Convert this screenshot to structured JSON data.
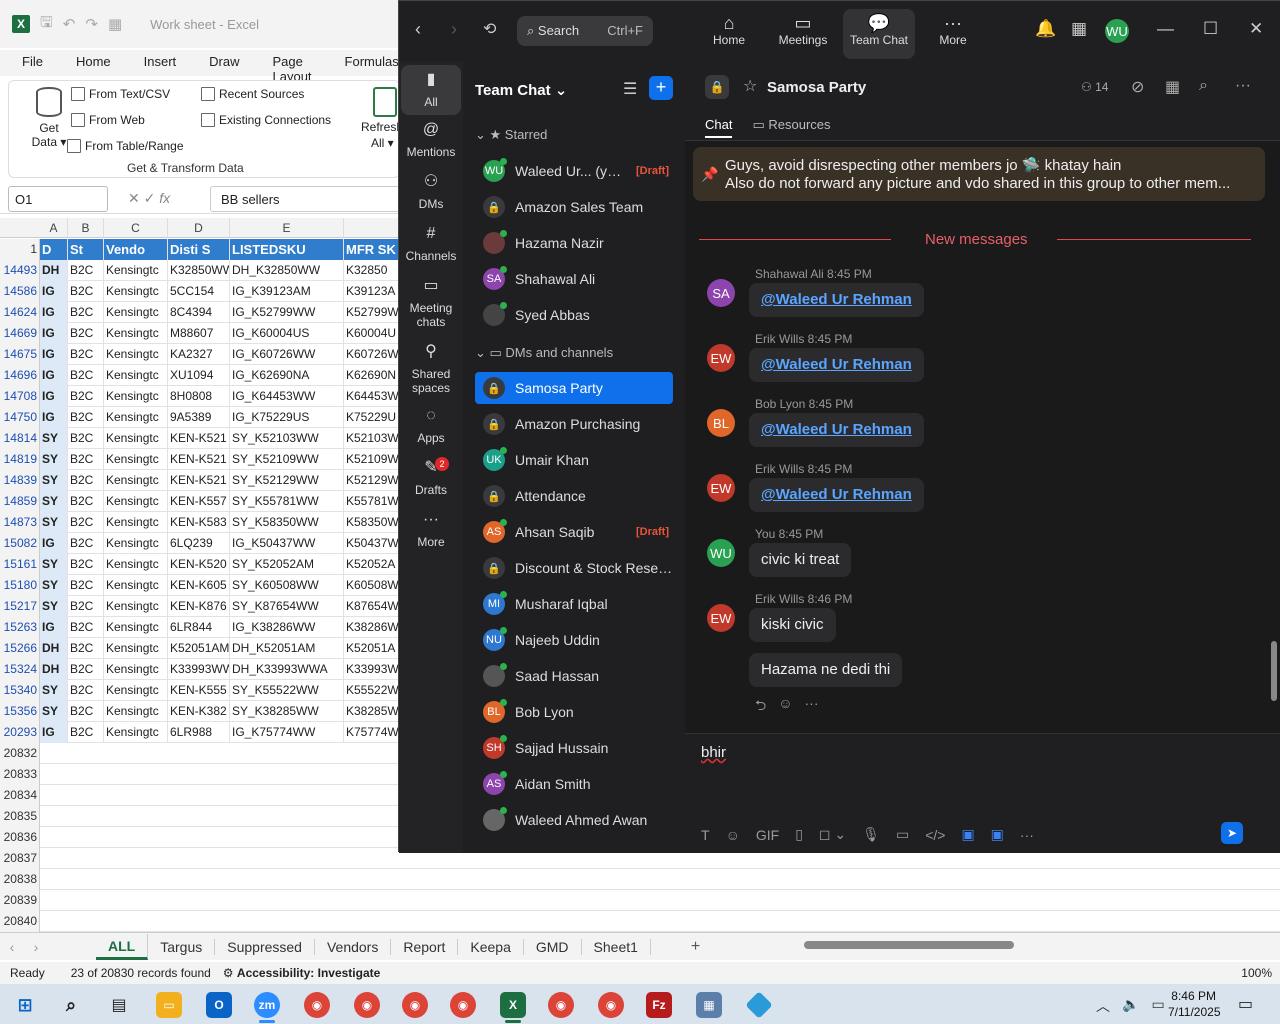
{
  "excel": {
    "title": "Work sheet  -  Excel",
    "menu": [
      "File",
      "Home",
      "Insert",
      "Draw",
      "Page Layout",
      "Formulas"
    ],
    "ribbon": {
      "get_data": "Get",
      "get_data_2": "Data",
      "from_text": "From Text/CSV",
      "from_web": "From Web",
      "from_table": "From Table/Range",
      "recent_sources": "Recent Sources",
      "existing_connections": "Existing Connections",
      "refresh": "Refresh",
      "refresh_2": "All",
      "group_label": "Get & Transform Data"
    },
    "name_box": "O1",
    "formula_value": "BB sellers",
    "columns": [
      "A",
      "B",
      "C",
      "D",
      "E"
    ],
    "header_row_number": "1",
    "header_cells": [
      "D",
      "St",
      "Vendo",
      "Disti S",
      "LISTEDSKU",
      "MFR SK"
    ],
    "rows": [
      {
        "n": "14493",
        "a": "DH",
        "b": "B2C",
        "c": "Kensingtc",
        "d": "K32850WW",
        "e": "DH_K32850WW",
        "f": "K32850"
      },
      {
        "n": "14586",
        "a": "IG",
        "b": "B2C",
        "c": "Kensingtc",
        "d": "5CC154",
        "e": "IG_K39123AM",
        "f": "K39123A"
      },
      {
        "n": "14624",
        "a": "IG",
        "b": "B2C",
        "c": "Kensingtc",
        "d": "8C4394",
        "e": "IG_K52799WW",
        "f": "K52799W"
      },
      {
        "n": "14669",
        "a": "IG",
        "b": "B2C",
        "c": "Kensingtc",
        "d": "M88607",
        "e": "IG_K60004US",
        "f": "K60004U"
      },
      {
        "n": "14675",
        "a": "IG",
        "b": "B2C",
        "c": "Kensingtc",
        "d": "KA2327",
        "e": "IG_K60726WW",
        "f": "K60726W"
      },
      {
        "n": "14696",
        "a": "IG",
        "b": "B2C",
        "c": "Kensingtc",
        "d": "XU1094",
        "e": "IG_K62690NA",
        "f": "K62690N"
      },
      {
        "n": "14708",
        "a": "IG",
        "b": "B2C",
        "c": "Kensingtc",
        "d": "8H0808",
        "e": "IG_K64453WW",
        "f": "K64453W"
      },
      {
        "n": "14750",
        "a": "IG",
        "b": "B2C",
        "c": "Kensingtc",
        "d": "9A5389",
        "e": "IG_K75229US",
        "f": "K75229U"
      },
      {
        "n": "14814",
        "a": "SY",
        "b": "B2C",
        "c": "Kensingtc",
        "d": "KEN-K521",
        "e": "SY_K52103WW",
        "f": "K52103W"
      },
      {
        "n": "14819",
        "a": "SY",
        "b": "B2C",
        "c": "Kensingtc",
        "d": "KEN-K521",
        "e": "SY_K52109WW",
        "f": "K52109W"
      },
      {
        "n": "14839",
        "a": "SY",
        "b": "B2C",
        "c": "Kensingtc",
        "d": "KEN-K521",
        "e": "SY_K52129WW",
        "f": "K52129W"
      },
      {
        "n": "14859",
        "a": "SY",
        "b": "B2C",
        "c": "Kensingtc",
        "d": "KEN-K557",
        "e": "SY_K55781WW",
        "f": "K55781W"
      },
      {
        "n": "14873",
        "a": "SY",
        "b": "B2C",
        "c": "Kensingtc",
        "d": "KEN-K583",
        "e": "SY_K58350WW",
        "f": "K58350W"
      },
      {
        "n": "15082",
        "a": "IG",
        "b": "B2C",
        "c": "Kensingtc",
        "d": "6LQ239",
        "e": "IG_K50437WW",
        "f": "K50437W"
      },
      {
        "n": "15161",
        "a": "SY",
        "b": "B2C",
        "c": "Kensingtc",
        "d": "KEN-K520",
        "e": "SY_K52052AM",
        "f": "K52052A"
      },
      {
        "n": "15180",
        "a": "SY",
        "b": "B2C",
        "c": "Kensingtc",
        "d": "KEN-K605",
        "e": "SY_K60508WW",
        "f": "K60508W"
      },
      {
        "n": "15217",
        "a": "SY",
        "b": "B2C",
        "c": "Kensingtc",
        "d": "KEN-K876",
        "e": "SY_K87654WW",
        "f": "K87654W"
      },
      {
        "n": "15263",
        "a": "IG",
        "b": "B2C",
        "c": "Kensingtc",
        "d": "6LR844",
        "e": "IG_K38286WW",
        "f": "K38286W"
      },
      {
        "n": "15266",
        "a": "DH",
        "b": "B2C",
        "c": "Kensingtc",
        "d": "K52051AM",
        "e": "DH_K52051AM",
        "f": "K52051A"
      },
      {
        "n": "15324",
        "a": "DH",
        "b": "B2C",
        "c": "Kensingtc",
        "d": "K33993WW",
        "e": "DH_K33993WWA",
        "f": "K33993W"
      },
      {
        "n": "15340",
        "a": "SY",
        "b": "B2C",
        "c": "Kensingtc",
        "d": "KEN-K555",
        "e": "SY_K55522WW",
        "f": "K55522W"
      },
      {
        "n": "15356",
        "a": "SY",
        "b": "B2C",
        "c": "Kensingtc",
        "d": "KEN-K382",
        "e": "SY_K38285WW",
        "f": "K38285W"
      },
      {
        "n": "20293",
        "a": "IG",
        "b": "B2C",
        "c": "Kensingtc",
        "d": "6LR988",
        "e": "IG_K75774WW",
        "f": "K75774W"
      }
    ],
    "empty_rows": [
      "20832",
      "20833",
      "20834",
      "20835",
      "20836",
      "20837",
      "20838",
      "20839",
      "20840"
    ],
    "sheet_tabs": [
      "ALL",
      "Targus",
      "Suppressed",
      "Vendors",
      "Report",
      "Keepa",
      "GMD",
      "Sheet1"
    ],
    "status_ready": "Ready",
    "status_records": "23 of 20830 records found",
    "status_accessibility": "Accessibility: Investigate",
    "zoom": "100%"
  },
  "zoom": {
    "search_label": "Search",
    "search_shortcut": "Ctrl+F",
    "nav": [
      "Home",
      "Meetings",
      "Team Chat",
      "More"
    ],
    "avatar_initials": "WU",
    "rail": [
      "All",
      "Mentions",
      "DMs",
      "Channels",
      "Meeting chats",
      "Shared spaces",
      "Apps",
      "Drafts",
      "More"
    ],
    "drafts_badge": "2",
    "list_title": "Team Chat",
    "starred_label": "Starred",
    "dms_label": "DMs and channels",
    "starred": [
      {
        "init": "WU",
        "name": "Waleed Ur... (you)",
        "draft": "[Draft]",
        "color": "#2aa152",
        "online": true
      },
      {
        "init": "🔒",
        "name": "Amazon Sales Team",
        "draft": "",
        "color": "lock",
        "online": false
      },
      {
        "init": "",
        "name": "Hazama Nazir",
        "draft": "",
        "color": "#6b3a3a",
        "online": true
      },
      {
        "init": "SA",
        "name": "Shahawal Ali",
        "draft": "",
        "color": "#8e44ad",
        "online": true
      },
      {
        "init": "",
        "name": "Syed Abbas",
        "draft": "",
        "color": "#444",
        "online": true
      }
    ],
    "channels": [
      {
        "init": "🔒",
        "name": "Samosa Party",
        "draft": "",
        "color": "lock",
        "online": false,
        "active": true
      },
      {
        "init": "🔒",
        "name": "Amazon Purchasing",
        "draft": "",
        "color": "lock",
        "online": false
      },
      {
        "init": "UK",
        "name": "Umair Khan",
        "draft": "",
        "color": "#1aa08a",
        "online": true
      },
      {
        "init": "🔒",
        "name": "Attendance",
        "draft": "",
        "color": "lock",
        "online": false
      },
      {
        "init": "AS",
        "name": "Ahsan Saqib",
        "draft": "[Draft]",
        "color": "#e0662a",
        "online": true
      },
      {
        "init": "🔒",
        "name": "Discount & Stock Reser...",
        "draft": "",
        "color": "lock",
        "online": false
      },
      {
        "init": "MI",
        "name": "Musharaf Iqbal",
        "draft": "",
        "color": "#2f78d1",
        "online": true
      },
      {
        "init": "NU",
        "name": "Najeeb Uddin",
        "draft": "",
        "color": "#2f78d1",
        "online": true
      },
      {
        "init": "",
        "name": "Saad Hassan",
        "draft": "",
        "color": "#555",
        "online": true
      },
      {
        "init": "BL",
        "name": "Bob Lyon",
        "draft": "",
        "color": "#e0662a",
        "online": true
      },
      {
        "init": "SH",
        "name": "Sajjad Hussain",
        "draft": "",
        "color": "#c0392b",
        "online": true
      },
      {
        "init": "AS",
        "name": "Aidan Smith",
        "draft": "",
        "color": "#8e44ad",
        "online": true
      },
      {
        "init": "",
        "name": "Waleed Ahmed Awan",
        "draft": "",
        "color": "#666",
        "online": true
      }
    ],
    "channel_name": "Samosa Party",
    "member_count": "14",
    "tabs": [
      "Chat",
      "Resources"
    ],
    "pinned_line1": "Guys, avoid disrespecting other members jo 🛸 khatay hain",
    "pinned_line2": "Also do not forward any picture and vdo shared in this group to other mem...",
    "new_messages_label": "New messages",
    "messages": [
      {
        "init": "SA",
        "color": "#8e44ad",
        "meta": "Shahawal Ali 8:45 PM",
        "text": "@Waleed Ur Rehman",
        "mention": true
      },
      {
        "init": "EW",
        "color": "#c0392b",
        "meta": "Erik Wills 8:45 PM",
        "text": "@Waleed Ur Rehman",
        "mention": true
      },
      {
        "init": "BL",
        "color": "#e0662a",
        "meta": "Bob Lyon 8:45 PM",
        "text": "@Waleed Ur Rehman",
        "mention": true
      },
      {
        "init": "EW",
        "color": "#c0392b",
        "meta": "Erik Wills 8:45 PM",
        "text": "@Waleed Ur Rehman",
        "mention": true
      },
      {
        "init": "WU",
        "color": "#2aa152",
        "meta": "You 8:45 PM",
        "text": "civic ki treat",
        "mention": false
      },
      {
        "init": "EW",
        "color": "#c0392b",
        "meta": "Erik Wills 8:46 PM",
        "text": "kiski civic",
        "mention": false
      }
    ],
    "followup_text": "Hazama ne dedi thi",
    "composer_text": "bhir"
  },
  "taskbar": {
    "time": "8:46 PM",
    "date": "7/11/2025"
  }
}
